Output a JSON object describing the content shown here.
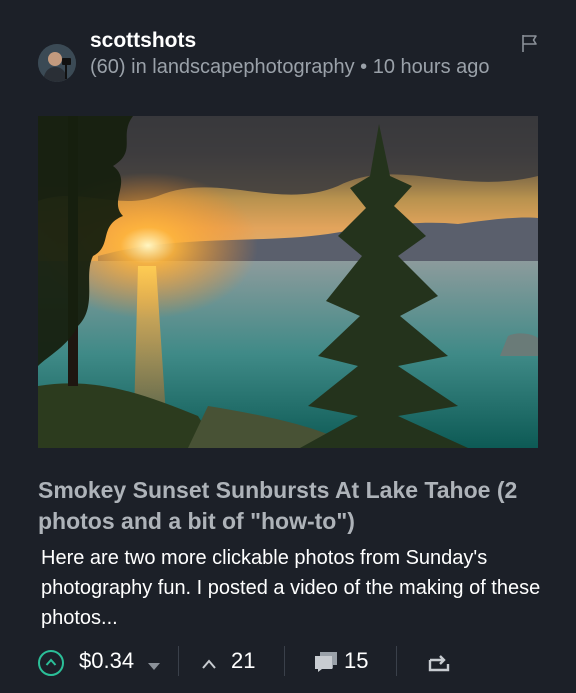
{
  "post": {
    "author": "scottshots",
    "meta_line": "(60) in landscapephotography • 10 hours ago",
    "title": "Smokey Sunset Sunbursts At Lake Tahoe (2 photos and a bit of \"how-to\")",
    "excerpt": "Here are two more clickable photos from Sunday's photography fun. I posted a video of the making of these photos...",
    "payout": "$0.34",
    "votes": "21",
    "comments": "15"
  },
  "icons": {
    "flag": "flag-icon",
    "upvote": "upvote-circle-icon",
    "dropdown": "chevron-down-icon",
    "votes": "chevron-up-icon",
    "comments": "comment-icon",
    "reblog": "reblog-icon"
  },
  "colors": {
    "background": "#1c2028",
    "accent": "#2bbf98",
    "muted_text": "#9aa1a9",
    "title_text": "#aeb3b9"
  }
}
